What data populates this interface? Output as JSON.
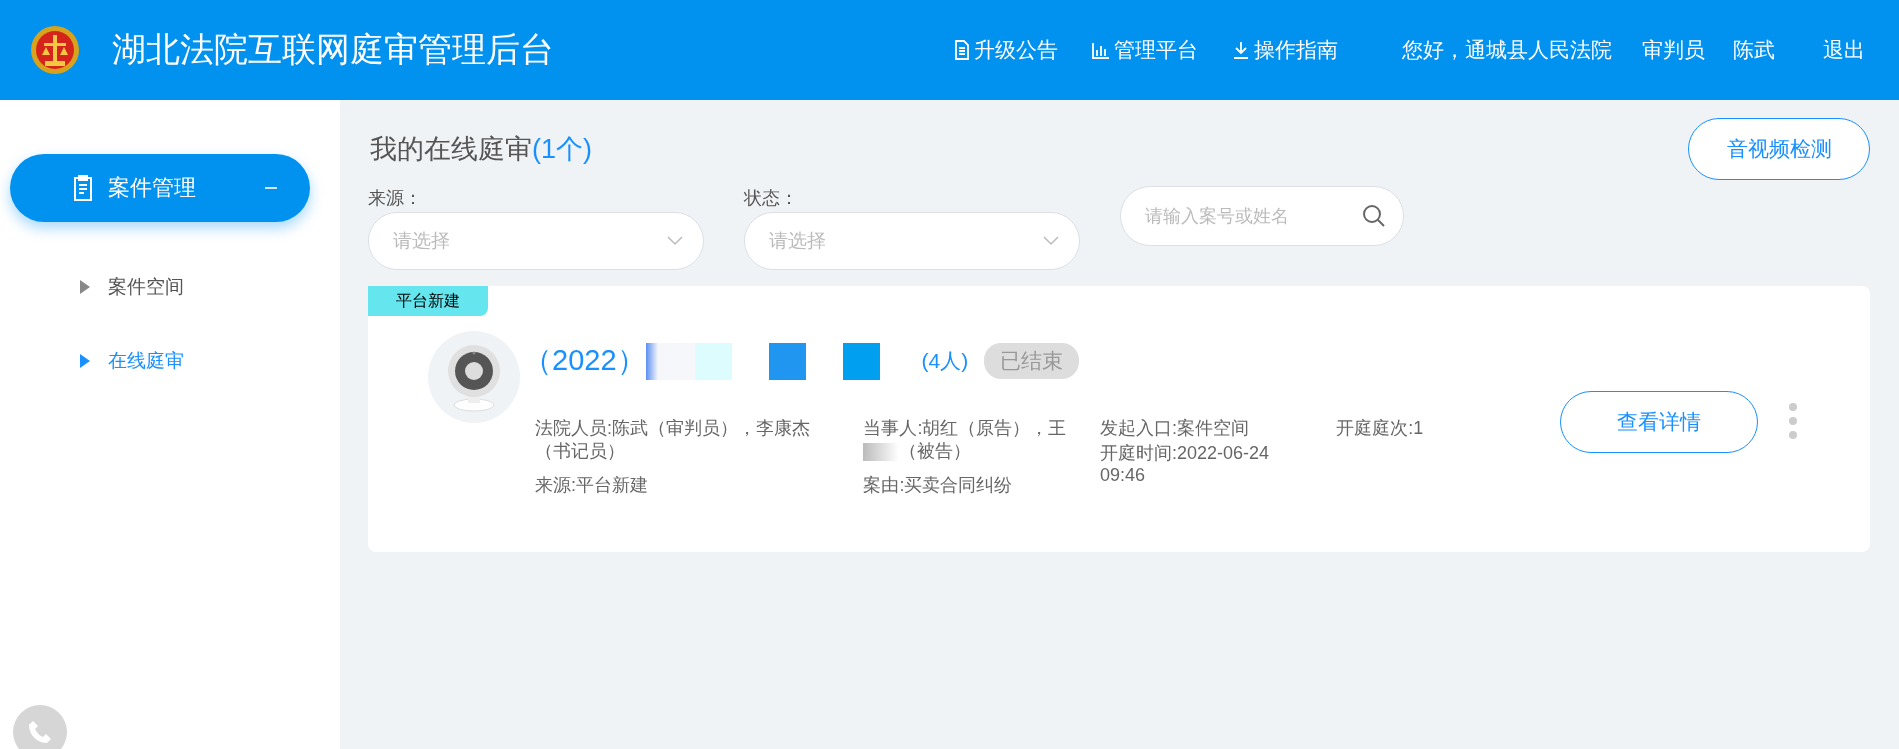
{
  "header": {
    "title": "湖北法院互联网庭审管理后台",
    "nav": [
      {
        "kind": "doc",
        "label": "升级公告"
      },
      {
        "kind": "chart",
        "label": "管理平台"
      },
      {
        "kind": "download",
        "label": "操作指南"
      }
    ],
    "greeting": "您好，通城县人民法院",
    "role": "审判员",
    "user": "陈武",
    "logout": "退出"
  },
  "sidebar": {
    "group": {
      "label": "案件管理",
      "expanded": true
    },
    "items": [
      {
        "label": "案件空间",
        "selected": false
      },
      {
        "label": "在线庭审",
        "selected": true
      }
    ]
  },
  "main": {
    "title": "我的在线庭审",
    "count": "(1个)",
    "av_check": "音视频检测",
    "filters": [
      {
        "label": "来源：",
        "placeholder": "请选择"
      },
      {
        "label": "状态：",
        "placeholder": "请选择"
      }
    ],
    "search": {
      "placeholder": "请输入案号或姓名"
    },
    "cases": [
      {
        "tag": "平台新建",
        "case_no": "（2022）",
        "people_count": "(4人)",
        "status": "已结束",
        "staff": "法院人员:陈武（审判员），李康杰（书记员）",
        "source": "来源:平台新建",
        "parties": "当事人:胡红（原告），王",
        "parties_rest": "（被告）",
        "cause": "案由:买卖合同纠纷",
        "entry": "发起入口:案件空间",
        "time": "开庭时间:2022-06-24 09:46",
        "session": "开庭庭次:1",
        "details": "查看详情"
      }
    ]
  }
}
